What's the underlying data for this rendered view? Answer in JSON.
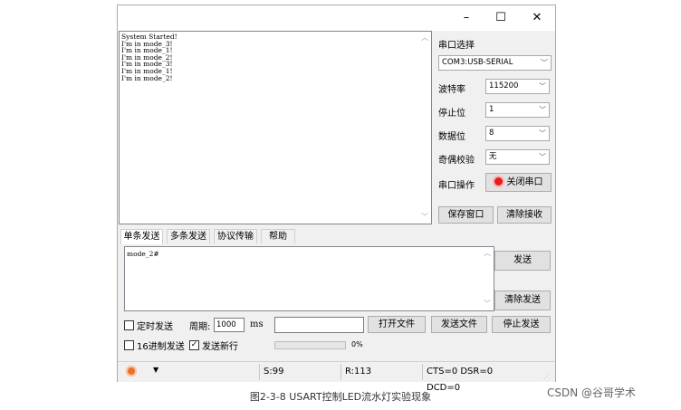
{
  "window": {
    "controls": {
      "minimize": "–",
      "maximize": "☐",
      "close": "✕"
    }
  },
  "receive": {
    "lines": "System Started!\nI'm in mode_3!\nI'm in mode_1!\nI'm in mode_2!\nI'm in mode_3!\nI'm in mode_1!\nI'm in mode_2!"
  },
  "settings": {
    "port_label": "串口选择",
    "port_value": "COM3:USB-SERIAL",
    "baud_label": "波特率",
    "baud_value": "115200",
    "stop_label": "停止位",
    "stop_value": "1",
    "data_label": "数据位",
    "data_value": "8",
    "parity_label": "奇偶校验",
    "parity_value": "无",
    "op_label": "串口操作",
    "op_button": "关闭串口",
    "save_button": "保存窗口",
    "clear_recv_button": "清除接收"
  },
  "tabs": [
    "单条发送",
    "多条发送",
    "协议传输",
    "帮助"
  ],
  "send": {
    "text": "mode_2#",
    "send_button": "发送",
    "clear_send_button": "清除发送"
  },
  "options": {
    "timed_label": "定时发送",
    "period_label": "周期:",
    "period_value": "1000",
    "period_unit": "ms",
    "open_file": "打开文件",
    "send_file": "发送文件",
    "stop_send": "停止发送",
    "hex_label": "16进制发送",
    "newline_label": "发送新行",
    "newline_checked": true,
    "progress_text": "0%",
    "progress": 0
  },
  "status": {
    "sent": "S:99",
    "recv": "R:113",
    "lines": "CTS=0 DSR=0 DCD=0"
  },
  "caption": "图2-3-8   USART控制LED流水灯实验现象",
  "watermark": "CSDN @谷哥学术"
}
